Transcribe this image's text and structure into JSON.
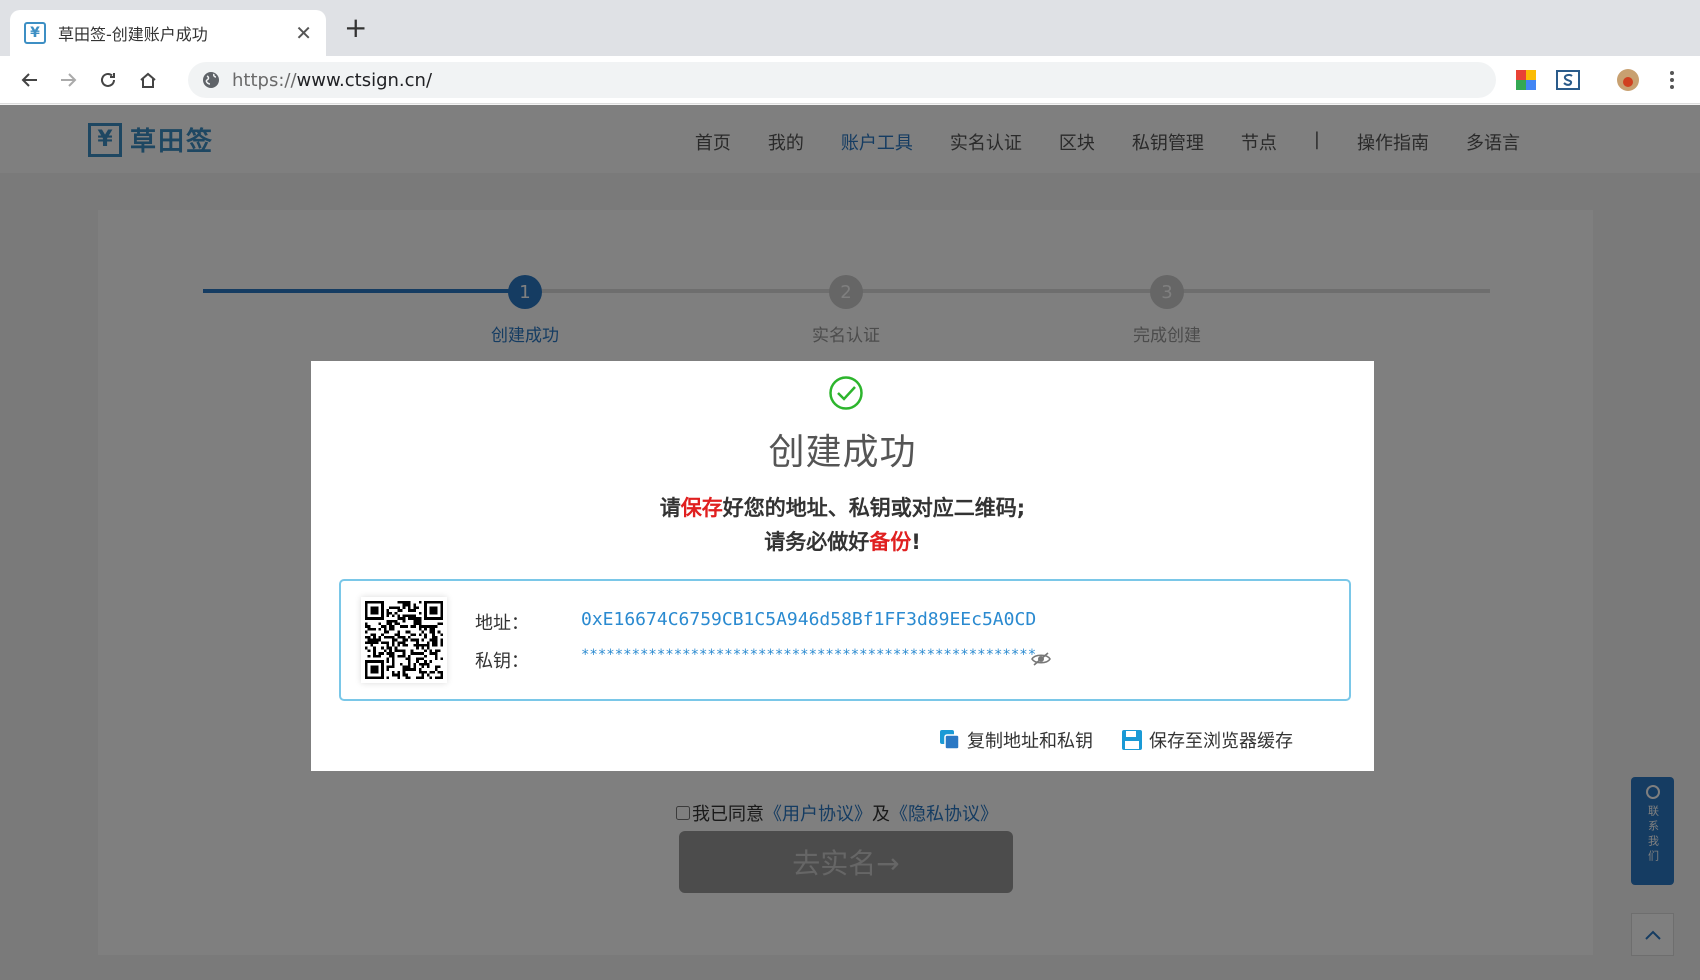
{
  "browser": {
    "tab_title": "草田签-创建账户成功",
    "url_scheme": "https://",
    "url_rest": "www.ctsign.cn/"
  },
  "site": {
    "logo_text": "草田签",
    "nav": [
      "首页",
      "我的",
      "账户工具",
      "实名认证",
      "区块",
      "私钥管理",
      "节点",
      "|",
      "操作指南",
      "多语言"
    ],
    "active_nav_index": 2
  },
  "steps": [
    {
      "number": "1",
      "label": "创建成功",
      "active": true
    },
    {
      "number": "2",
      "label": "实名认证",
      "active": false
    },
    {
      "number": "3",
      "label": "完成创建",
      "active": false
    }
  ],
  "modal": {
    "title": "创建成功",
    "msg_line1_a": "请",
    "msg_line1_red": "保存",
    "msg_line1_b": "好您的地址、私钥或对应二维码;",
    "msg_line2_a": "请务必做好",
    "msg_line2_red": "备份",
    "msg_line2_b": "!",
    "address_label": "地址：",
    "address_value": "0xE16674C6759CB1C5A946d58Bf1FF3d89EEc5A0CD",
    "key_label": "私钥：",
    "key_value": "******************************************************",
    "copy_action": "复制地址和私钥",
    "save_action": "保存至浏览器缓存"
  },
  "footer": {
    "agree_prefix": "我已同意",
    "user_agreement": "《用户协议》",
    "and": "及",
    "privacy_agreement": "《隐私协议》",
    "go_button": "去实名→"
  },
  "float": {
    "contact": "联系我们"
  },
  "colors": {
    "brand": "#2a78c4",
    "success": "#2db52d",
    "highlight": "#e02020",
    "box_border": "#7ac7e8"
  }
}
